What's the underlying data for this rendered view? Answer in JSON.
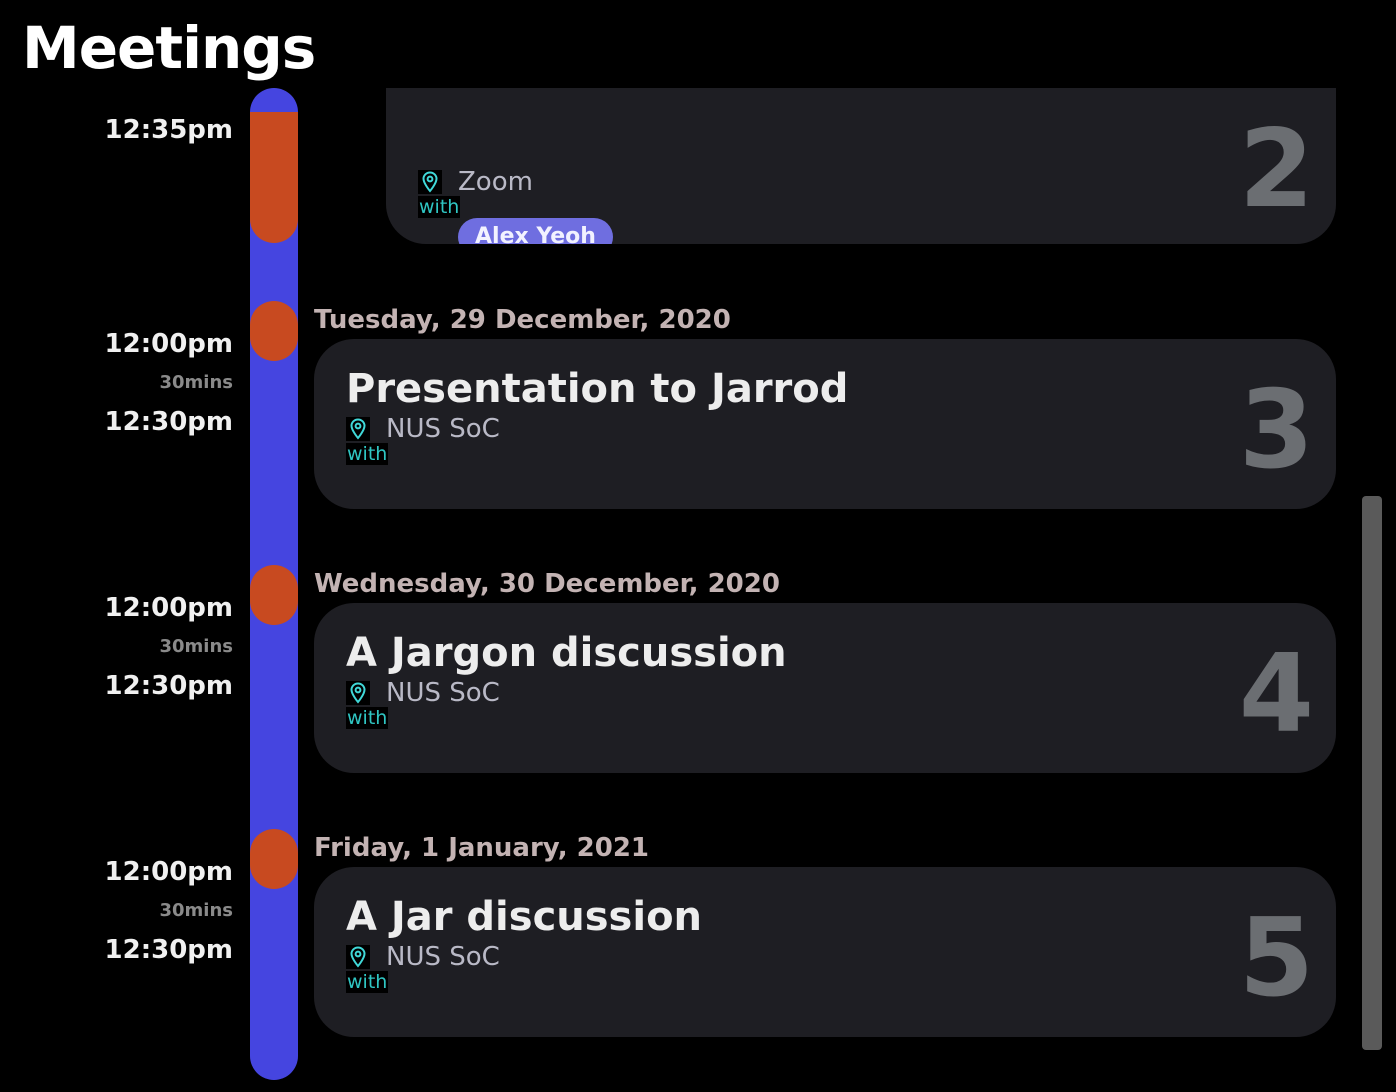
{
  "page": {
    "title": "Meetings"
  },
  "colors": {
    "background": "#000000",
    "timeline": "#4545e0",
    "marker": "#c84a20",
    "card": "#1e1e23",
    "date": "#c3b3b3",
    "accent_with": "#2fc6c3",
    "participant_chip": "#6f6ee0",
    "index_number": "#6b6e72"
  },
  "meetings": [
    {
      "index": "2",
      "date": "",
      "title": "",
      "location_icon": "map-pin-icon",
      "location": "Zoom",
      "with_label": "with",
      "participants": [
        "Alex Yeoh"
      ],
      "start": "12:35pm",
      "duration": "",
      "end": ""
    },
    {
      "index": "3",
      "date": "Tuesday, 29 December, 2020",
      "title": "Presentation to Jarrod",
      "location_icon": "map-pin-icon",
      "location": "NUS SoC",
      "with_label": "with",
      "participants": [],
      "start": "12:00pm",
      "duration": "30mins",
      "end": "12:30pm"
    },
    {
      "index": "4",
      "date": "Wednesday, 30 December, 2020",
      "title": "A Jargon discussion",
      "location_icon": "map-pin-icon",
      "location": "NUS SoC",
      "with_label": "with",
      "participants": [],
      "start": "12:00pm",
      "duration": "30mins",
      "end": "12:30pm"
    },
    {
      "index": "5",
      "date": "Friday, 1 January, 2021",
      "title": "A Jar discussion",
      "location_icon": "map-pin-icon",
      "location": "NUS SoC",
      "with_label": "with",
      "participants": [],
      "start": "12:00pm",
      "duration": "30mins",
      "end": "12:30pm"
    }
  ]
}
